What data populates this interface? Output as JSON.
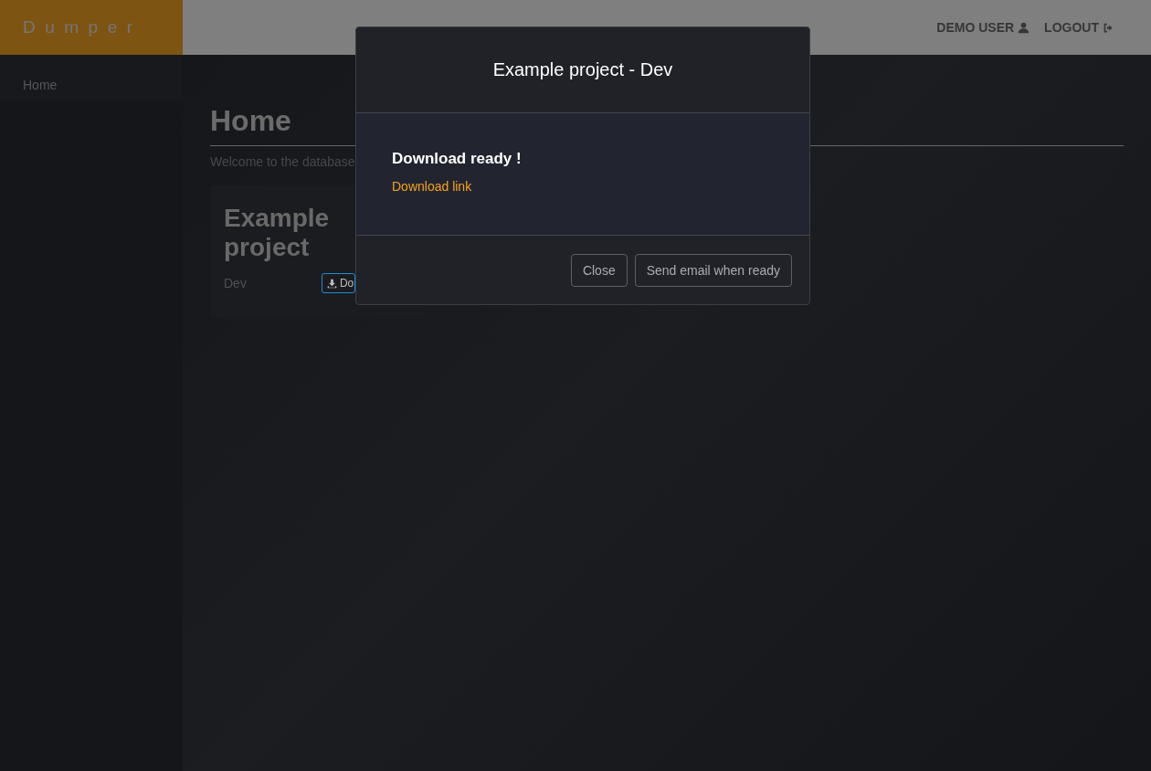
{
  "navbar": {
    "brand": "Dumper",
    "links": [
      {
        "label": "DEMO USER",
        "kind": "user"
      },
      {
        "label": "LOGOUT",
        "kind": "logout"
      }
    ]
  },
  "sidebar": {
    "items": [
      {
        "label": "Home",
        "selected": true
      }
    ]
  },
  "page": {
    "title": "Home",
    "subtitle": "Welcome to the database",
    "cards": [
      {
        "title": "Example project",
        "environment": "Dev",
        "button": "Do"
      }
    ]
  },
  "modal": {
    "title": "Example project - Dev",
    "heading": "Download ready !",
    "link": "Download link",
    "buttons": [
      "Close",
      "Send email when ready"
    ]
  }
}
